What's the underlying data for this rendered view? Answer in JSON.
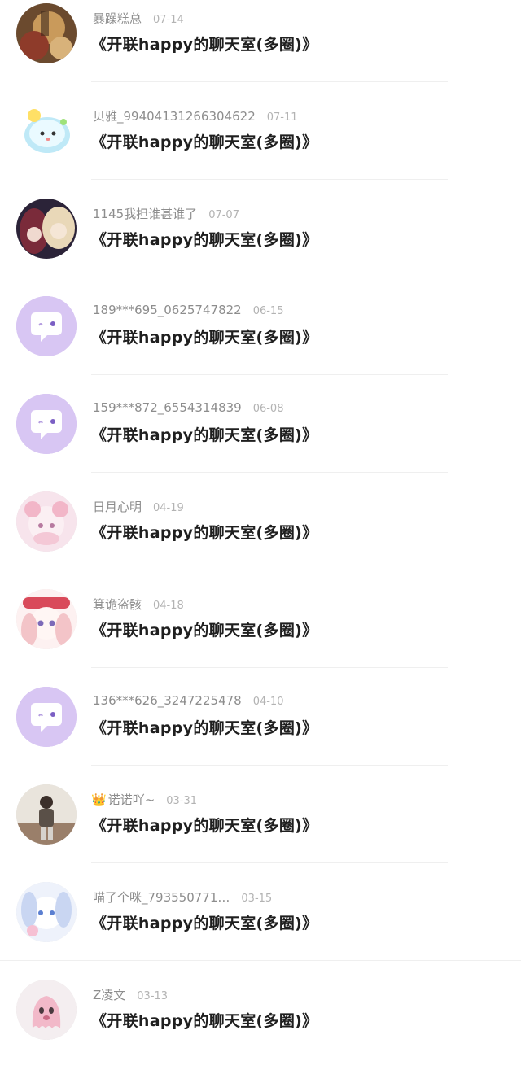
{
  "messages": [
    {
      "name": "暴躁糕总",
      "date": "07-14",
      "title": "《开联happy的聊天室(多圈)》",
      "avatar": "photo-gold",
      "crown": ""
    },
    {
      "name": "贝雅_99404131266304622",
      "date": "07-11",
      "title": "《开联happy的聊天室(多圈)》",
      "avatar": "cartoon-yellow",
      "crown": ""
    },
    {
      "name": "1145我担谁甚谁了",
      "date": "07-07",
      "title": "《开联happy的聊天室(多圈)》",
      "avatar": "anime-dark",
      "crown": ""
    },
    {
      "name": "189***695_0625747822",
      "date": "06-15",
      "title": "《开联happy的聊天室(多圈)》",
      "avatar": "default-purple",
      "crown": ""
    },
    {
      "name": "159***872_6554314839",
      "date": "06-08",
      "title": "《开联happy的聊天室(多圈)》",
      "avatar": "default-purple",
      "crown": ""
    },
    {
      "name": "日月心明",
      "date": "04-19",
      "title": "《开联happy的聊天室(多圈)》",
      "avatar": "anime-pink",
      "crown": ""
    },
    {
      "name": "箕诡盗骸",
      "date": "04-18",
      "title": "《开联happy的聊天室(多圈)》",
      "avatar": "anime-pink2",
      "crown": ""
    },
    {
      "name": "136***626_3247225478",
      "date": "04-10",
      "title": "《开联happy的聊天室(多圈)》",
      "avatar": "default-purple",
      "crown": ""
    },
    {
      "name": "诺诺吖~",
      "date": "03-31",
      "title": "《开联happy的聊天室(多圈)》",
      "avatar": "photo-person",
      "crown": "👑"
    },
    {
      "name": "喵了个咪_793550771…",
      "date": "03-15",
      "title": "《开联happy的聊天室(多圈)》",
      "avatar": "anime-blue",
      "crown": ""
    },
    {
      "name": "Z凌文",
      "date": "03-13",
      "title": "《开联happy的聊天室(多圈)》",
      "avatar": "ghost-pink",
      "crown": ""
    }
  ],
  "colors": {
    "default_avatar": "#d8c6f3",
    "default_avatar_bubble": "#ffffff",
    "name_text": "#8d8d8d",
    "date_text": "#b3b3b3",
    "title_text": "#1f1f1f",
    "divider": "#efefef"
  }
}
